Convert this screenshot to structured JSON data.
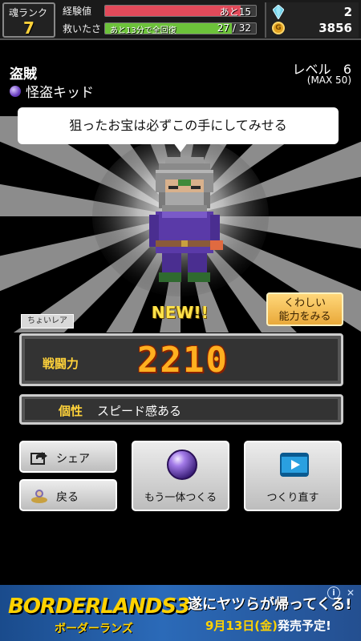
{
  "status": {
    "rank_label": "魂ランク",
    "rank_value": "7",
    "exp_label": "経験値",
    "exp_text": "あと15",
    "exp_fill_fraction": 0.9,
    "rescue_label": "救いたさ",
    "rescue_text": "27 / 32",
    "rescue_subtext": "あと13分で全回復",
    "rescue_fill_fraction": 0.84,
    "gems": "2",
    "coins": "3856"
  },
  "character": {
    "job": "盗賊",
    "title": "怪盗キッド",
    "level_label": "レベル",
    "level_value": "6",
    "level_max": "(MAX 50)",
    "speech": "狙ったお宝は必ずこの手にしてみせる",
    "new_label": "NEW!!",
    "rarity": "ちょいレア",
    "detail_button": "くわしい\n能力をみる",
    "power_label": "戦闘力",
    "power_value": "2210",
    "trait_label": "個性",
    "trait_value": "スピード感ある"
  },
  "buttons": {
    "share": "シェア",
    "back": "戻る",
    "more": "もう一体つくる",
    "redo": "つくり直す"
  },
  "ad": {
    "logo": "BORDERLANDS3",
    "logo_sub": "ボーダーランズ",
    "headline": "遂にヤツらが帰ってくる!",
    "date": "9月13日(金)",
    "sub": "発売予定!",
    "info_icon": "i",
    "close_icon": "✕"
  },
  "colors": {
    "exp_bar": "#e24a5a",
    "rescue_bar": "#6cc23a",
    "power_text": "#ffb020",
    "accent_yellow": "#ffd23a"
  }
}
